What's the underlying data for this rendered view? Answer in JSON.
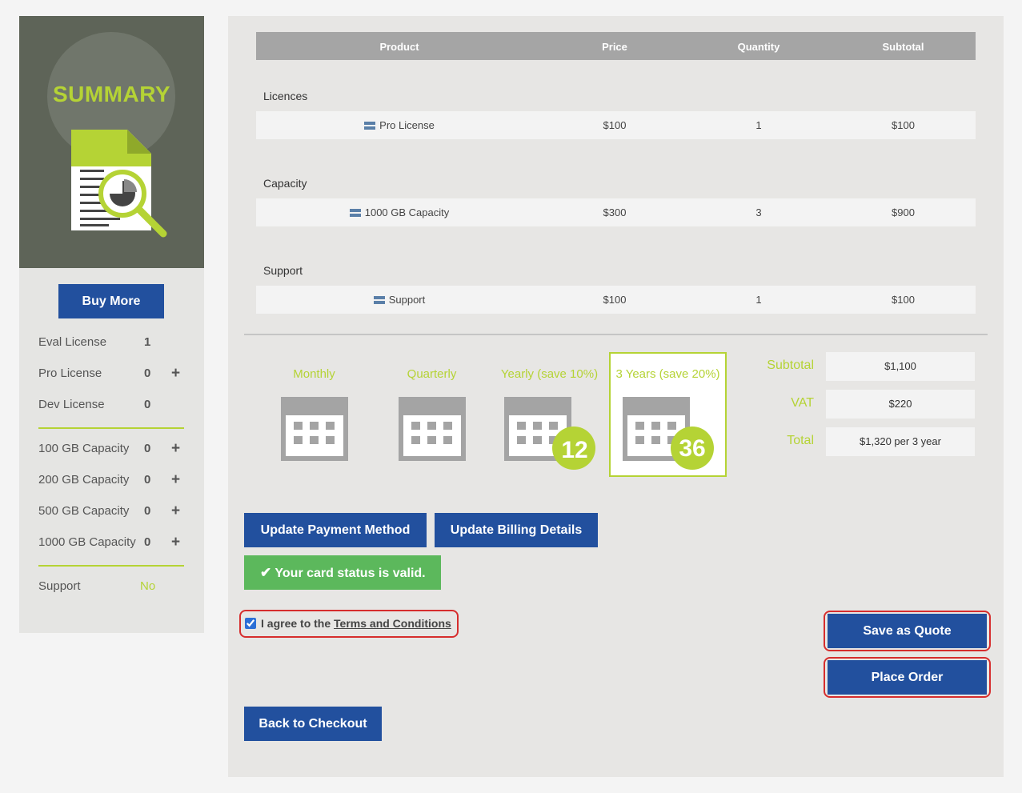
{
  "sidebar": {
    "summary_title": "SUMMARY",
    "buy_more_label": "Buy More",
    "licenses": [
      {
        "label": "Eval License",
        "count": "1",
        "addable": false
      },
      {
        "label": "Pro License",
        "count": "0",
        "addable": true
      },
      {
        "label": "Dev License",
        "count": "0",
        "addable": false
      }
    ],
    "capacities": [
      {
        "label": "100 GB Capacity",
        "count": "0"
      },
      {
        "label": "200 GB Capacity",
        "count": "0"
      },
      {
        "label": "500 GB Capacity",
        "count": "0"
      },
      {
        "label": "1000 GB Capacity",
        "count": "0"
      }
    ],
    "plus_symbol": "+",
    "support": {
      "label": "Support",
      "value": "No"
    }
  },
  "table": {
    "headers": [
      "Product",
      "Price",
      "Quantity",
      "Subtotal"
    ],
    "sections": [
      {
        "label": "Licences",
        "product": "Pro License",
        "price": "$100",
        "quantity": "1",
        "subtotal": "$100"
      },
      {
        "label": "Capacity",
        "product": "1000 GB Capacity",
        "price": "$300",
        "quantity": "3",
        "subtotal": "$900"
      },
      {
        "label": "Support",
        "product": "Support",
        "price": "$100",
        "quantity": "1",
        "subtotal": "$100"
      }
    ]
  },
  "plans": [
    {
      "label": "Monthly",
      "badge": "",
      "selected": false
    },
    {
      "label": "Quarterly",
      "badge": "",
      "selected": false
    },
    {
      "label": "Yearly (save 10%)",
      "badge": "12",
      "selected": false
    },
    {
      "label": "3 Years (save 20%)",
      "badge": "36",
      "selected": true
    }
  ],
  "totals": {
    "subtotal_label": "Subtotal",
    "subtotal_value": "$1,100",
    "vat_label": "VAT",
    "vat_value": "$220",
    "total_label": "Total",
    "total_value": "$1,320 per 3 year"
  },
  "actions": {
    "update_payment": "Update Payment Method",
    "update_billing": "Update Billing Details",
    "card_status": "Your card status is valid.",
    "terms_prefix": "I agree to the ",
    "terms_link": "Terms and Conditions",
    "terms_checked": true,
    "save_quote": "Save as Quote",
    "place_order": "Place Order",
    "back_checkout": "Back to Checkout"
  },
  "colors": {
    "accent": "#b5d335",
    "primary": "#22509e",
    "success": "#5cb85c",
    "highlight": "#d62d2d",
    "sidebar_dark": "#5e6458"
  },
  "icons": [
    "document-chart-icon",
    "magnifier-icon",
    "list-row-icon",
    "calendar-icon",
    "checkmark-icon",
    "plus-icon"
  ]
}
